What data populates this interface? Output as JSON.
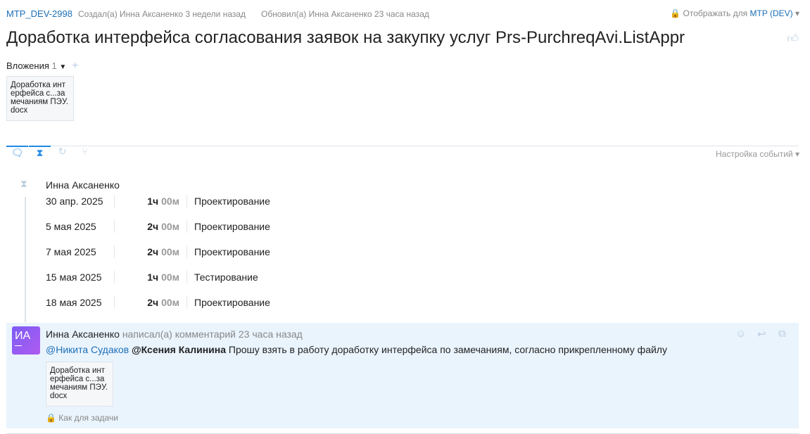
{
  "header": {
    "key": "MTP_DEV-2998",
    "created": "Создал(а) Инна Аксаненко 3 недели назад",
    "updated": "Обновил(а) Инна Аксаненко 23 часа назад",
    "visibility_label": "Отображать для",
    "visibility_value": "MTP (DEV)"
  },
  "title": "Доработка интерфейса согласования заявок на закупку услуг Prs-PurchreqAvi.ListAppr",
  "attachments": {
    "label": "Вложения",
    "count": "1",
    "file": "Доработка интерфейса с...замечаниям ПЭУ.docx"
  },
  "tabs": [
    {
      "icon": "comment-icon"
    },
    {
      "icon": "hourglass-icon"
    },
    {
      "icon": "history-icon"
    },
    {
      "icon": "branch-icon"
    }
  ],
  "events_settings": "Настройка событий",
  "worklog": {
    "author": "Инна Аксаненко",
    "rows": [
      {
        "date": "30 апр. 2025",
        "hours": "1ч",
        "minutes": "00м",
        "type": "Проектирование"
      },
      {
        "date": "5 мая 2025",
        "hours": "2ч",
        "minutes": "00м",
        "type": "Проектирование"
      },
      {
        "date": "7 мая 2025",
        "hours": "2ч",
        "minutes": "00м",
        "type": "Проектирование"
      },
      {
        "date": "15 мая 2025",
        "hours": "1ч",
        "minutes": "00м",
        "type": "Тестирование"
      },
      {
        "date": "18 мая 2025",
        "hours": "2ч",
        "minutes": "00м",
        "type": "Проектирование"
      }
    ]
  },
  "comment": {
    "initials": "ИА",
    "author": "Инна Аксаненко",
    "action": "написал(а) комментарий 23 часа назад",
    "mention1": "@Никита Судаков",
    "mention2": "@Ксения Калинина",
    "text": "Прошу взять в работу доработку интерфейса по замечаниям, согласно прикрепленному файлу",
    "file": "Доработка интерфейса с...замечаниям ПЭУ.docx",
    "privacy": "Как для задачи"
  }
}
